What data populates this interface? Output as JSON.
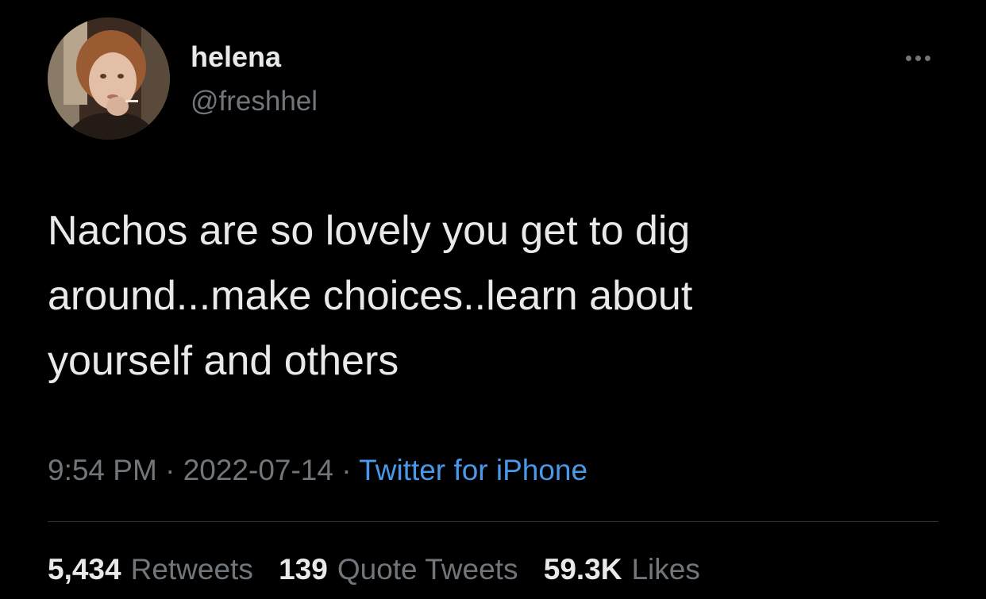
{
  "user": {
    "display_name": "helena",
    "handle": "@freshhel",
    "avatar": "profile-photo"
  },
  "more_icon": "ellipsis-icon",
  "tweet": {
    "text": "Nachos are so lovely you get to dig\naround...make choices..learn about\nyourself and others",
    "time": "9:54 PM",
    "separator": " · ",
    "date": "2022-07-14",
    "source": "Twitter for iPhone"
  },
  "stats": {
    "retweets_count": "5,434",
    "retweets_label": "Retweets",
    "quotes_count": "139",
    "quotes_label": "Quote Tweets",
    "likes_count": "59.3K",
    "likes_label": "Likes"
  },
  "colors": {
    "background": "#000000",
    "primary_text": "#e7e9ea",
    "secondary_text": "#71767b",
    "link": "#4a99e9",
    "divider": "#2f3336"
  }
}
